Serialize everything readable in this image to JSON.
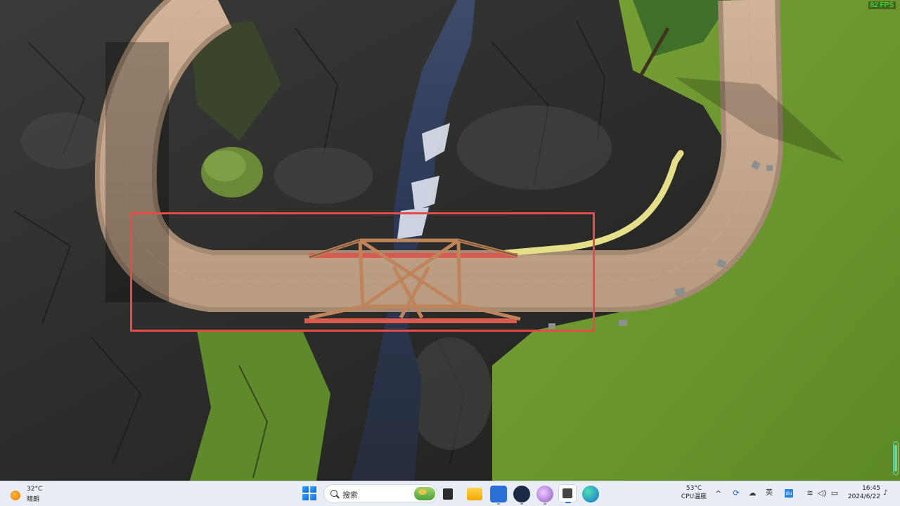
{
  "game": {
    "fps_label": "82 FPS"
  },
  "taskbar": {
    "weather": {
      "temp": "32°C",
      "desc": "晴朗",
      "icon": "sun-icon"
    },
    "search": {
      "placeholder": "搜索"
    },
    "pinned_apps": [
      "task-view",
      "file-explorer",
      "bird-app",
      "steam",
      "game-app",
      "active-game",
      "edge"
    ],
    "cpu": {
      "temp": "53°C",
      "label": "CPU温度"
    },
    "tray": {
      "chevron": "^",
      "lang": "英",
      "app2": "du"
    },
    "clock": {
      "time": "16:45",
      "date": "2024/6/22"
    }
  },
  "colors": {
    "selection_box": "#e84a4a",
    "fps_text": "#3cff3c",
    "taskbar_bg": "#e9eef6"
  }
}
